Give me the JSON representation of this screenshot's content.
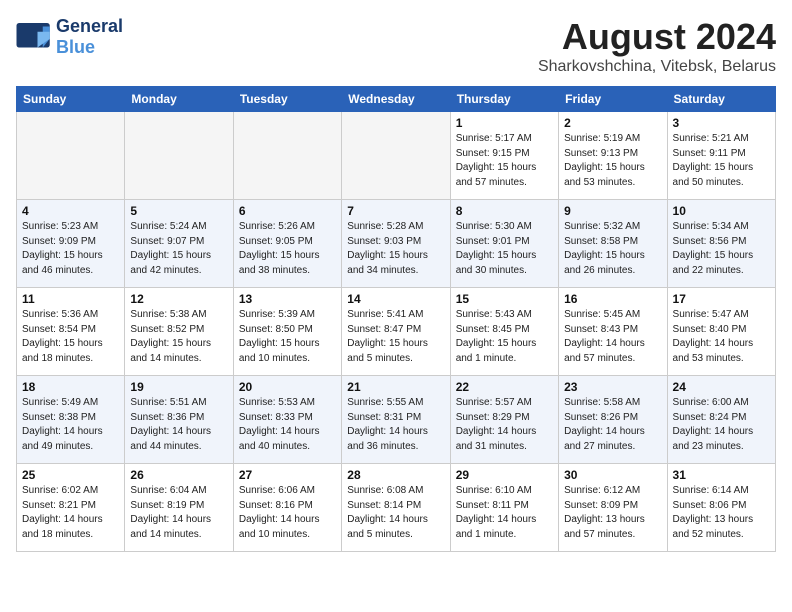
{
  "header": {
    "logo_line1": "General",
    "logo_line2": "Blue",
    "month": "August 2024",
    "location": "Sharkovshchina, Vitebsk, Belarus"
  },
  "weekdays": [
    "Sunday",
    "Monday",
    "Tuesday",
    "Wednesday",
    "Thursday",
    "Friday",
    "Saturday"
  ],
  "weeks": [
    [
      {
        "day": "",
        "info": ""
      },
      {
        "day": "",
        "info": ""
      },
      {
        "day": "",
        "info": ""
      },
      {
        "day": "",
        "info": ""
      },
      {
        "day": "1",
        "info": "Sunrise: 5:17 AM\nSunset: 9:15 PM\nDaylight: 15 hours\nand 57 minutes."
      },
      {
        "day": "2",
        "info": "Sunrise: 5:19 AM\nSunset: 9:13 PM\nDaylight: 15 hours\nand 53 minutes."
      },
      {
        "day": "3",
        "info": "Sunrise: 5:21 AM\nSunset: 9:11 PM\nDaylight: 15 hours\nand 50 minutes."
      }
    ],
    [
      {
        "day": "4",
        "info": "Sunrise: 5:23 AM\nSunset: 9:09 PM\nDaylight: 15 hours\nand 46 minutes."
      },
      {
        "day": "5",
        "info": "Sunrise: 5:24 AM\nSunset: 9:07 PM\nDaylight: 15 hours\nand 42 minutes."
      },
      {
        "day": "6",
        "info": "Sunrise: 5:26 AM\nSunset: 9:05 PM\nDaylight: 15 hours\nand 38 minutes."
      },
      {
        "day": "7",
        "info": "Sunrise: 5:28 AM\nSunset: 9:03 PM\nDaylight: 15 hours\nand 34 minutes."
      },
      {
        "day": "8",
        "info": "Sunrise: 5:30 AM\nSunset: 9:01 PM\nDaylight: 15 hours\nand 30 minutes."
      },
      {
        "day": "9",
        "info": "Sunrise: 5:32 AM\nSunset: 8:58 PM\nDaylight: 15 hours\nand 26 minutes."
      },
      {
        "day": "10",
        "info": "Sunrise: 5:34 AM\nSunset: 8:56 PM\nDaylight: 15 hours\nand 22 minutes."
      }
    ],
    [
      {
        "day": "11",
        "info": "Sunrise: 5:36 AM\nSunset: 8:54 PM\nDaylight: 15 hours\nand 18 minutes."
      },
      {
        "day": "12",
        "info": "Sunrise: 5:38 AM\nSunset: 8:52 PM\nDaylight: 15 hours\nand 14 minutes."
      },
      {
        "day": "13",
        "info": "Sunrise: 5:39 AM\nSunset: 8:50 PM\nDaylight: 15 hours\nand 10 minutes."
      },
      {
        "day": "14",
        "info": "Sunrise: 5:41 AM\nSunset: 8:47 PM\nDaylight: 15 hours\nand 5 minutes."
      },
      {
        "day": "15",
        "info": "Sunrise: 5:43 AM\nSunset: 8:45 PM\nDaylight: 15 hours\nand 1 minute."
      },
      {
        "day": "16",
        "info": "Sunrise: 5:45 AM\nSunset: 8:43 PM\nDaylight: 14 hours\nand 57 minutes."
      },
      {
        "day": "17",
        "info": "Sunrise: 5:47 AM\nSunset: 8:40 PM\nDaylight: 14 hours\nand 53 minutes."
      }
    ],
    [
      {
        "day": "18",
        "info": "Sunrise: 5:49 AM\nSunset: 8:38 PM\nDaylight: 14 hours\nand 49 minutes."
      },
      {
        "day": "19",
        "info": "Sunrise: 5:51 AM\nSunset: 8:36 PM\nDaylight: 14 hours\nand 44 minutes."
      },
      {
        "day": "20",
        "info": "Sunrise: 5:53 AM\nSunset: 8:33 PM\nDaylight: 14 hours\nand 40 minutes."
      },
      {
        "day": "21",
        "info": "Sunrise: 5:55 AM\nSunset: 8:31 PM\nDaylight: 14 hours\nand 36 minutes."
      },
      {
        "day": "22",
        "info": "Sunrise: 5:57 AM\nSunset: 8:29 PM\nDaylight: 14 hours\nand 31 minutes."
      },
      {
        "day": "23",
        "info": "Sunrise: 5:58 AM\nSunset: 8:26 PM\nDaylight: 14 hours\nand 27 minutes."
      },
      {
        "day": "24",
        "info": "Sunrise: 6:00 AM\nSunset: 8:24 PM\nDaylight: 14 hours\nand 23 minutes."
      }
    ],
    [
      {
        "day": "25",
        "info": "Sunrise: 6:02 AM\nSunset: 8:21 PM\nDaylight: 14 hours\nand 18 minutes."
      },
      {
        "day": "26",
        "info": "Sunrise: 6:04 AM\nSunset: 8:19 PM\nDaylight: 14 hours\nand 14 minutes."
      },
      {
        "day": "27",
        "info": "Sunrise: 6:06 AM\nSunset: 8:16 PM\nDaylight: 14 hours\nand 10 minutes."
      },
      {
        "day": "28",
        "info": "Sunrise: 6:08 AM\nSunset: 8:14 PM\nDaylight: 14 hours\nand 5 minutes."
      },
      {
        "day": "29",
        "info": "Sunrise: 6:10 AM\nSunset: 8:11 PM\nDaylight: 14 hours\nand 1 minute."
      },
      {
        "day": "30",
        "info": "Sunrise: 6:12 AM\nSunset: 8:09 PM\nDaylight: 13 hours\nand 57 minutes."
      },
      {
        "day": "31",
        "info": "Sunrise: 6:14 AM\nSunset: 8:06 PM\nDaylight: 13 hours\nand 52 minutes."
      }
    ]
  ]
}
